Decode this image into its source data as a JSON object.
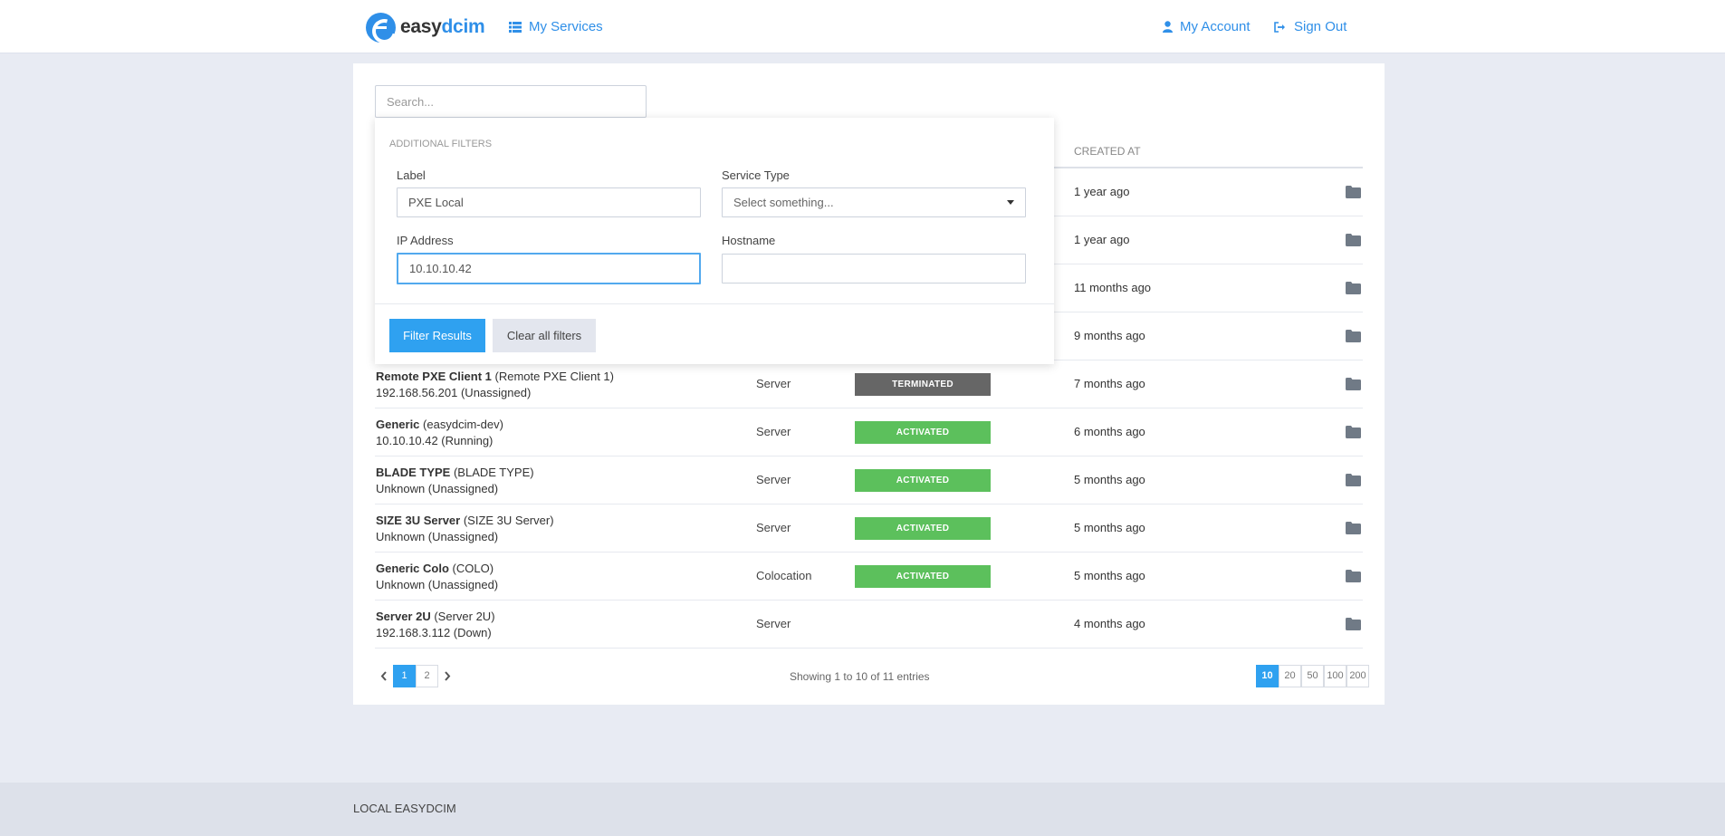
{
  "brand": {
    "name_dark": "easy",
    "name_accent": "dcim"
  },
  "nav": {
    "my_services": "My Services",
    "my_account": "My Account",
    "sign_out": "Sign Out"
  },
  "search": {
    "placeholder": "Search...",
    "value": ""
  },
  "table": {
    "created_header": "CREATED AT",
    "rows": [
      {
        "name": "",
        "label": "",
        "ip": "",
        "type": "",
        "status": "",
        "created": "1 year ago"
      },
      {
        "name": "",
        "label": "",
        "ip": "",
        "type": "",
        "status": "",
        "created": "1 year ago"
      },
      {
        "name": "",
        "label": "",
        "ip": "",
        "type": "",
        "status": "",
        "created": "11 months ago"
      },
      {
        "name": "",
        "label": "",
        "ip": "",
        "type": "",
        "status": "",
        "created": "9 months ago"
      },
      {
        "name": "Remote PXE Client 1",
        "label": "(Remote PXE Client 1)",
        "ip": "192.168.56.201 (Unassigned)",
        "type": "Server",
        "status": "TERMINATED",
        "created": "7 months ago"
      },
      {
        "name": "Generic",
        "label": "(easydcim-dev)",
        "ip": "10.10.10.42 (Running)",
        "type": "Server",
        "status": "ACTIVATED",
        "created": "6 months ago"
      },
      {
        "name": "BLADE TYPE",
        "label": "(BLADE TYPE)",
        "ip": "Unknown (Unassigned)",
        "type": "Server",
        "status": "ACTIVATED",
        "created": "5 months ago"
      },
      {
        "name": "SIZE 3U Server",
        "label": "(SIZE 3U Server)",
        "ip": "Unknown (Unassigned)",
        "type": "Server",
        "status": "ACTIVATED",
        "created": "5 months ago"
      },
      {
        "name": "Generic Colo",
        "label": "(COLO)",
        "ip": "Unknown (Unassigned)",
        "type": "Colocation",
        "status": "ACTIVATED",
        "created": "5 months ago"
      },
      {
        "name": "Server 2U",
        "label": "(Server 2U)",
        "ip": "192.168.3.112 (Down)",
        "type": "Server",
        "status": "",
        "created": "4 months ago"
      }
    ]
  },
  "pagination": {
    "pages": [
      "1",
      "2"
    ],
    "current": "1",
    "entries_text": "Showing 1 to 10 of 11 entries",
    "sizes": [
      "10",
      "20",
      "50",
      "100",
      "200"
    ],
    "current_size": "10"
  },
  "filters": {
    "title": "ADDITIONAL FILTERS",
    "label_label": "Label",
    "label_value": "PXE Local",
    "service_type_label": "Service Type",
    "service_type_placeholder": "Select something...",
    "ip_label": "IP Address",
    "ip_value": "10.10.10.42 ",
    "hostname_label": "Hostname",
    "hostname_value": "",
    "filter_button": "Filter Results",
    "clear_button": "Clear all filters"
  },
  "footer": {
    "text": "LOCAL EASYDCIM"
  },
  "colors": {
    "accent": "#2fa1f0",
    "activated": "#5cc05c",
    "terminated": "#666666",
    "brand": "#2f8fe8"
  }
}
